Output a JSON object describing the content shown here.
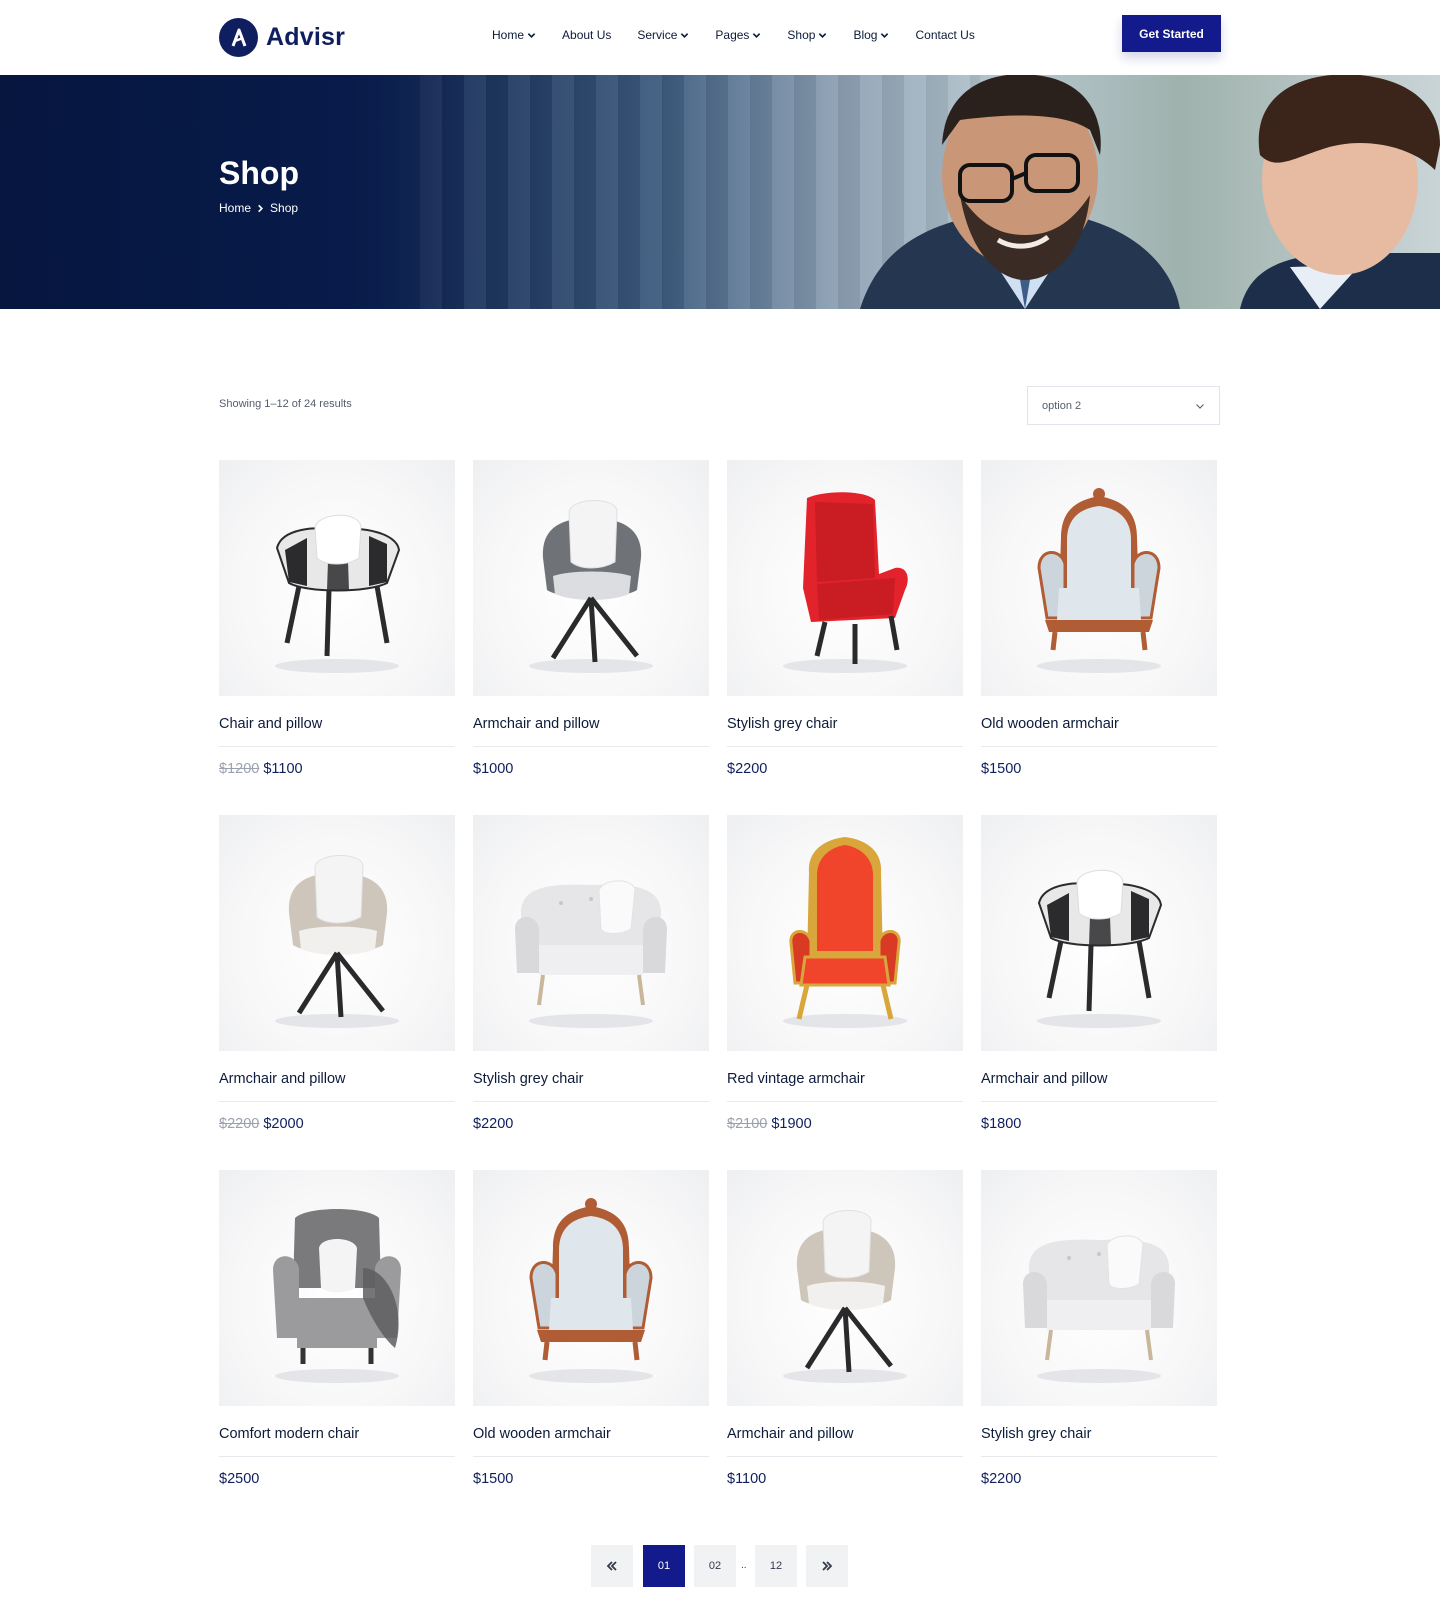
{
  "header": {
    "logo_text": "Advisr",
    "nav": [
      {
        "label": "Home",
        "dropdown": true
      },
      {
        "label": "About Us",
        "dropdown": false
      },
      {
        "label": "Service",
        "dropdown": true
      },
      {
        "label": "Pages",
        "dropdown": true
      },
      {
        "label": "Shop",
        "dropdown": true
      },
      {
        "label": "Blog",
        "dropdown": true
      },
      {
        "label": "Contact Us",
        "dropdown": false
      }
    ],
    "cta_label": "Get Started"
  },
  "hero": {
    "title": "Shop",
    "breadcrumb": [
      "Home",
      "Shop"
    ]
  },
  "toolbar": {
    "results_text": "Showing 1–12 of 24 results",
    "sort_value": "option 2"
  },
  "products": [
    {
      "name": "Chair and pillow",
      "old_price": "$1200",
      "price": "$1100",
      "image": "plaid-chair-icon",
      "colors": [
        "#2b2b2e",
        "#e8e8e8",
        "#ffffff"
      ]
    },
    {
      "name": "Armchair and pillow",
      "old_price": "",
      "price": "$1000",
      "image": "grey-swivel-chair-icon",
      "colors": [
        "#6f7378",
        "#dcdde0",
        "#2a2a2c"
      ]
    },
    {
      "name": "Stylish grey chair",
      "old_price": "",
      "price": "$2200",
      "image": "red-wingback-chair-icon",
      "colors": [
        "#e3232b",
        "#c91c23",
        "#2a2a2c"
      ]
    },
    {
      "name": "Old wooden armchair",
      "old_price": "",
      "price": "$1500",
      "image": "wooden-armchair-icon",
      "colors": [
        "#b05c34",
        "#dfe6ec",
        "#cdd5dc"
      ]
    },
    {
      "name": "Armchair and pillow",
      "old_price": "$2200",
      "price": "$2000",
      "image": "beige-swivel-chair-icon",
      "colors": [
        "#cfc6bb",
        "#f2f0ee",
        "#2a2a2c"
      ]
    },
    {
      "name": "Stylish grey chair",
      "old_price": "",
      "price": "$2200",
      "image": "white-tufted-chair-icon",
      "colors": [
        "#e6e6e8",
        "#d9d9dc",
        "#c9b79c"
      ]
    },
    {
      "name": "Red vintage armchair",
      "old_price": "$2100",
      "price": "$1900",
      "image": "red-throne-chair-icon",
      "colors": [
        "#f0452b",
        "#d8a63a",
        "#d83a24"
      ]
    },
    {
      "name": "Armchair and pillow",
      "old_price": "",
      "price": "$1800",
      "image": "plaid-chair-icon",
      "colors": [
        "#2b2b2e",
        "#e8e8e8",
        "#ffffff"
      ]
    },
    {
      "name": "Comfort modern chair",
      "old_price": "",
      "price": "$2500",
      "image": "grey-wingback-chair-icon",
      "colors": [
        "#7a7a7c",
        "#9b9b9e",
        "#5e5e60"
      ]
    },
    {
      "name": "Old wooden armchair",
      "old_price": "",
      "price": "$1500",
      "image": "wooden-armchair-icon",
      "colors": [
        "#b05c34",
        "#dfe6ec",
        "#cdd5dc"
      ]
    },
    {
      "name": "Armchair and pillow",
      "old_price": "",
      "price": "$1100",
      "image": "beige-swivel-chair-icon",
      "colors": [
        "#cfc6bb",
        "#f2f0ee",
        "#2a2a2c"
      ]
    },
    {
      "name": "Stylish grey chair",
      "old_price": "",
      "price": "$2200",
      "image": "white-tufted-chair-icon",
      "colors": [
        "#e6e6e8",
        "#d9d9dc",
        "#c9b79c"
      ]
    }
  ],
  "pagination": {
    "prev_icon": "double-chevron-left-icon",
    "pages": [
      "01",
      "02",
      "12"
    ],
    "ellipsis": "..",
    "active": "01",
    "next_icon": "double-chevron-right-icon"
  },
  "colors": {
    "brand": "#131a8c",
    "navy": "#0f1e5e",
    "text": "#0c1b3a",
    "muted": "#9aa2b0"
  }
}
